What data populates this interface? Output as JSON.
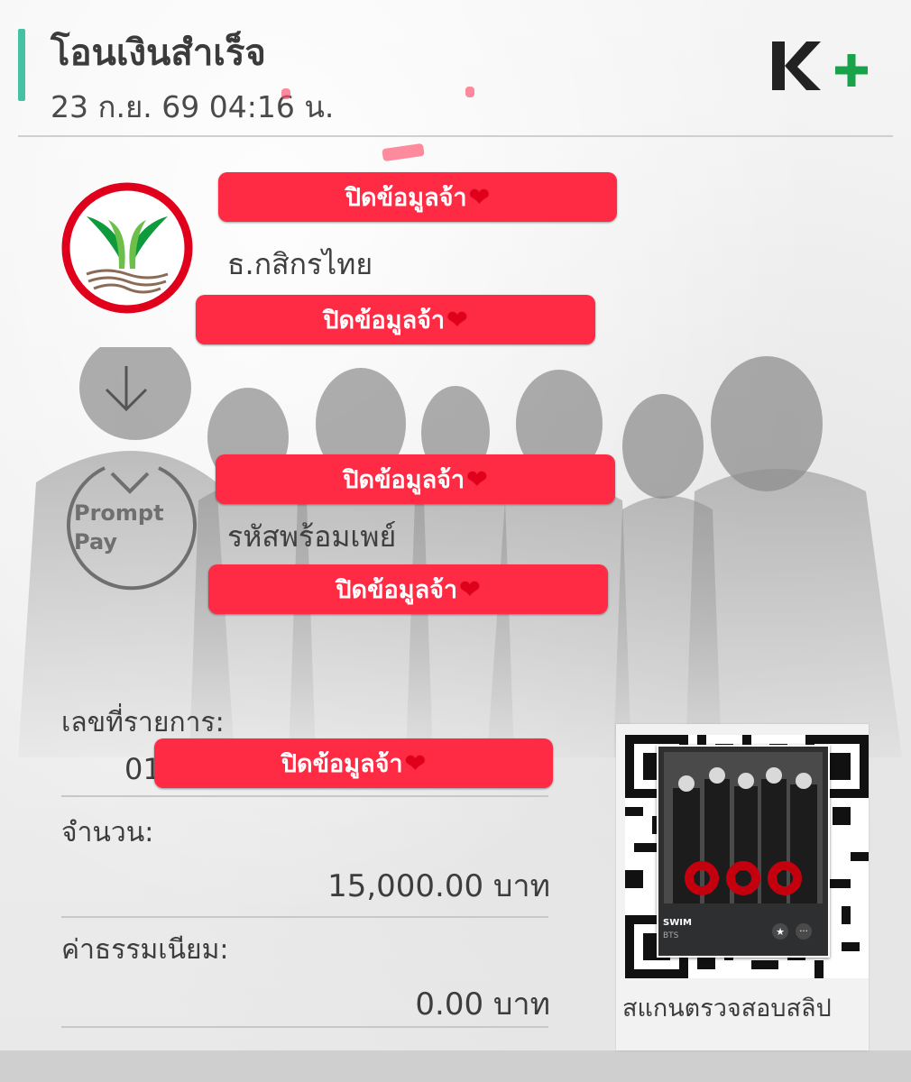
{
  "header": {
    "title": "โอนเงินสำเร็จ",
    "datetime": "23 ก.ย. 69  04:16 น.",
    "logo_text": "K+"
  },
  "colors": {
    "accent": "#45c2a1",
    "kplus_green": "#18a34a",
    "kbank_green": "#0e9a3d",
    "redact_red": "#ff2a44",
    "kbank_ring": "#e0001b"
  },
  "sender": {
    "redact_name": "ปิดข้อมูลจ้า",
    "bank": "ธ.กสิกรไทย",
    "redact_account": "ปิดข้อมูลจ้า"
  },
  "receiver": {
    "redact_name": "ปิดข้อมูลจ้า",
    "logo_text_top": "Prompt",
    "logo_text_bottom": "Pay",
    "id_label": "รหัสพร้อมเพย์",
    "redact_id": "ปิดข้อมูลจ้า"
  },
  "details": {
    "ref_label": "เลขที่รายการ:",
    "ref_value_visible": "01",
    "ref_redact": "ปิดข้อมูลจ้า",
    "amount_label": "จำนวน:",
    "amount_value": "15,000.00 บาท",
    "fee_label": "ค่าธรรมเนียม:",
    "fee_value": "0.00 บาท"
  },
  "qr": {
    "album_title": "SWIM",
    "album_artist": "BTS",
    "scan_label": "สแกนตรวจสอบสลิป"
  },
  "icons": {
    "heart": "❤",
    "star": "★",
    "more": "···"
  }
}
